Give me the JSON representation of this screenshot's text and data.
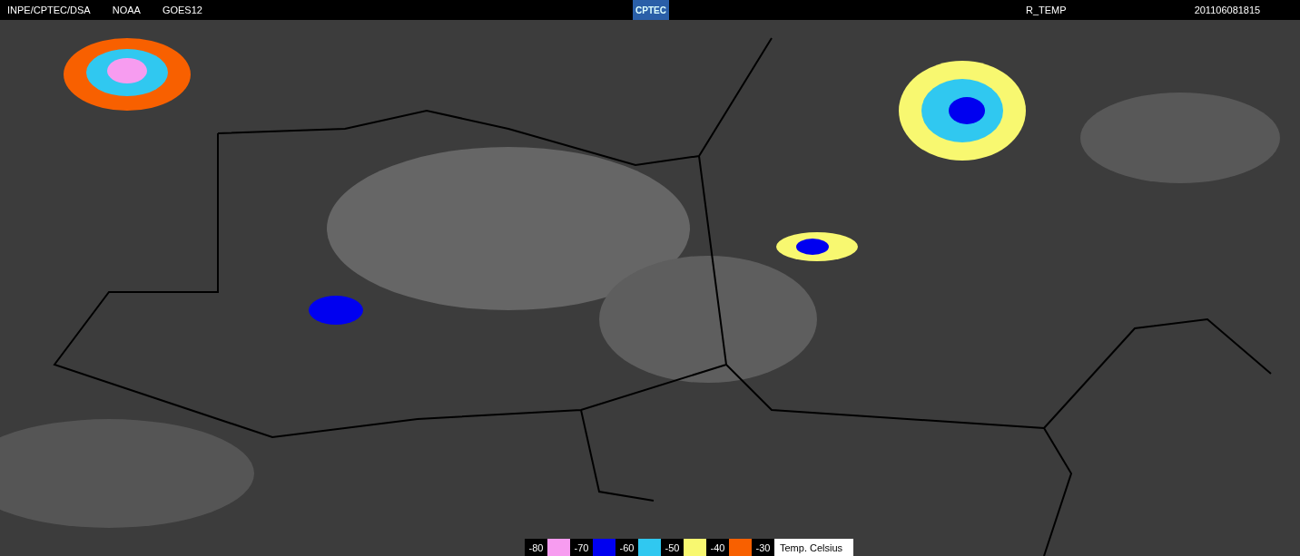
{
  "header": {
    "left": [
      "INPE/CPTEC/DSA",
      "NOAA",
      "GOES12"
    ],
    "logo": "CPTEC",
    "product": "R_TEMP",
    "timestamp": "201106081815"
  },
  "legend": {
    "items": [
      {
        "label": "-80",
        "color": "#f79cf0"
      },
      {
        "label": "-70",
        "color": "#0000f0"
      },
      {
        "label": "-60",
        "color": "#30c8f0"
      },
      {
        "label": "-50",
        "color": "#f8f870"
      },
      {
        "label": "-40",
        "color": "#f86000"
      },
      {
        "label": "-30"
      }
    ],
    "unit": "Temp. Celsius"
  }
}
